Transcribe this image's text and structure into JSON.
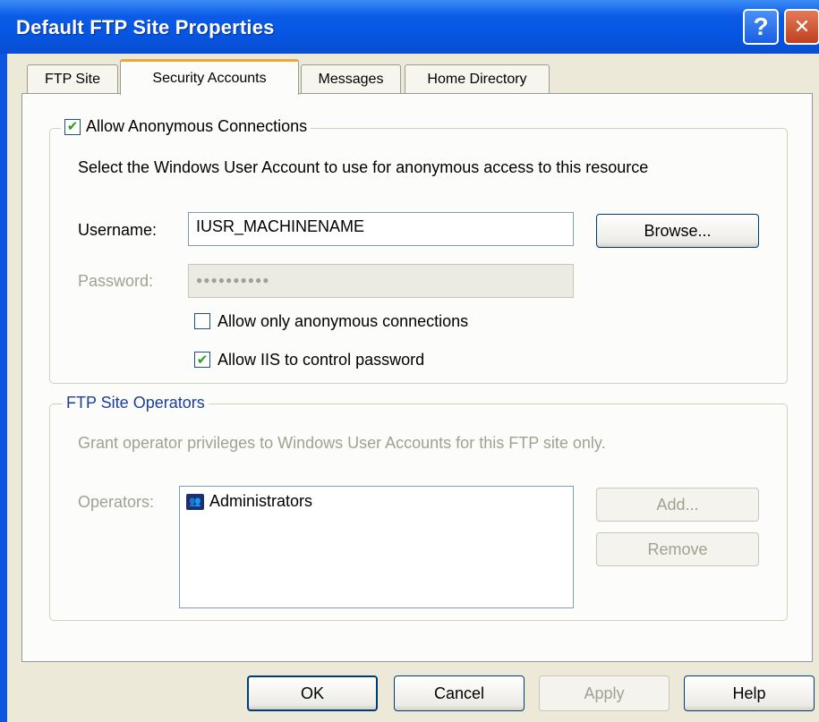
{
  "window": {
    "title": "Default FTP Site Properties",
    "help_glyph": "?",
    "close_glyph": "✕"
  },
  "tabs": [
    {
      "label": "FTP Site",
      "active": false
    },
    {
      "label": "Security Accounts",
      "active": true
    },
    {
      "label": "Messages",
      "active": false
    },
    {
      "label": "Home Directory",
      "active": false
    }
  ],
  "anonymous": {
    "checkbox_label": "Allow Anonymous Connections",
    "checked": true,
    "description": "Select the Windows User Account to use for anonymous access to this resource",
    "username_label": "Username:",
    "username_value": "IUSR_MACHINENAME",
    "browse_label": "Browse...",
    "password_label": "Password:",
    "password_value": "●●●●●●●●●●",
    "allow_only_anonymous_label": "Allow only anonymous connections",
    "allow_only_anonymous_checked": false,
    "iis_control_password_label": "Allow IIS to control password",
    "iis_control_password_checked": true
  },
  "operators_group": {
    "legend": "FTP Site Operators",
    "description": "Grant operator privileges to Windows User Accounts for this FTP site only.",
    "operators_label": "Operators:",
    "operators": [
      "Administrators"
    ],
    "add_label": "Add...",
    "remove_label": "Remove"
  },
  "footer": {
    "ok_label": "OK",
    "cancel_label": "Cancel",
    "apply_label": "Apply",
    "help_label": "Help"
  },
  "colors": {
    "titlebar": "#0557e3",
    "check_green": "#21a121",
    "tab_accent": "#f0a63a"
  }
}
